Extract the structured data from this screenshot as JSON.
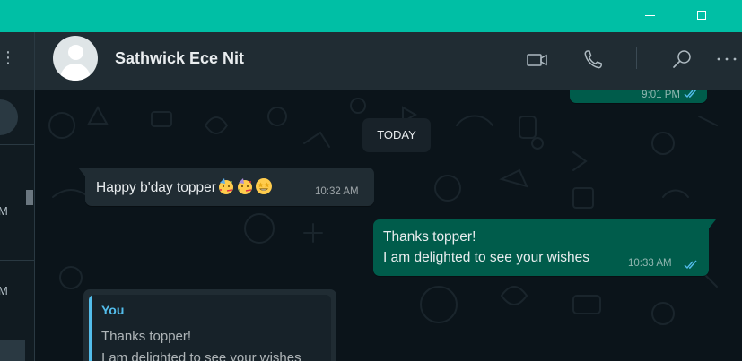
{
  "window": {
    "minimize_label": "Minimize",
    "maximize_label": "Maximize"
  },
  "sidebar": {
    "menu_icon": "more-vertical-icon",
    "chat_times": [
      "M",
      "M"
    ]
  },
  "chat_header": {
    "contact_name": "Sathwick Ece Nit",
    "icons": [
      "video-call-icon",
      "voice-call-icon",
      "search-icon",
      "more-horizontal-icon"
    ]
  },
  "chat": {
    "previous_message": {
      "time": "9:01 PM",
      "status_icon": "double-check-read-icon"
    },
    "date_divider": "TODAY",
    "messages": [
      {
        "direction": "incoming",
        "text": "Happy b'day topper",
        "emojis": [
          "partying-face-emoji",
          "partying-face-emoji",
          "star-struck-emoji"
        ],
        "time": "10:32 AM"
      },
      {
        "direction": "outgoing",
        "lines": [
          "Thanks topper!",
          "I am delighted to see your wishes"
        ],
        "time": "10:33 AM",
        "status_icon": "double-check-read-icon"
      }
    ],
    "reply_preview": {
      "author": "You",
      "lines": [
        "Thanks topper!",
        "I am delighted to see your wishes"
      ]
    }
  },
  "colors": {
    "titlebar": "#00bfa5",
    "header": "#202c33",
    "background": "#0b141a",
    "outgoing_bubble": "#005c4b",
    "incoming_bubble": "#202c33",
    "read_tick": "#53bdeb"
  }
}
